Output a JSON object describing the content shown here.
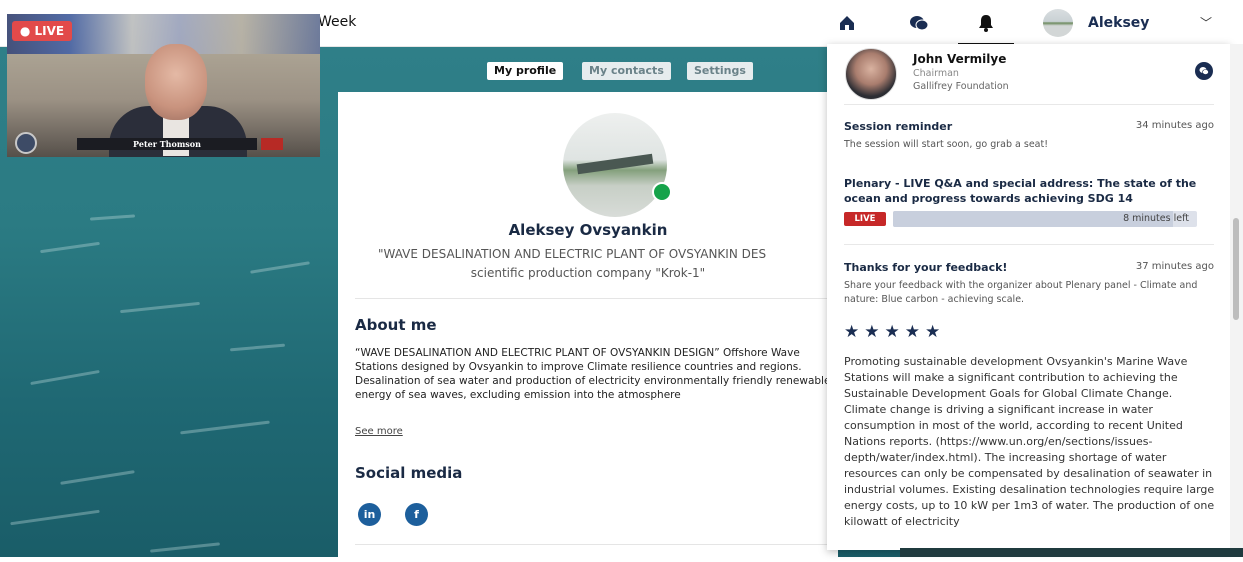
{
  "header": {
    "brand_text": "Week",
    "nav": [
      {
        "icon": "home-icon"
      },
      {
        "icon": "chat-icon"
      },
      {
        "icon": "bell-icon",
        "active": true
      }
    ],
    "user_name": "Aleksey",
    "chevron": "﹀"
  },
  "video": {
    "live_label": "● LIVE",
    "speaker_name": "Peter Thomson"
  },
  "tabs": [
    "My profile",
    "My contacts",
    "Settings"
  ],
  "profile": {
    "name": "Aleksey Ovsyankin",
    "title": "\"WAVE DESALINATION AND ELECTRIC PLANT OF OVSYANKIN DES",
    "company": "scientific production company \"Krok-1\"",
    "about_heading": "About me",
    "about_text": "“WAVE DESALINATION AND ELECTRIC PLANT OF OVSYANKIN DESIGN” Offshore Wave Stations designed by Ovsyankin to improve Climate resilience countries and regions. Desalination of sea water and production of electricity environmentally friendly renewable energy of sea waves, excluding emission into the atmosphere",
    "see_more": "See more",
    "social_heading": "Social media",
    "social": [
      {
        "label": "in",
        "icon": "linkedin-icon"
      },
      {
        "label": "f",
        "icon": "facebook-icon"
      }
    ]
  },
  "notifications": {
    "contact": {
      "name": "John Vermilye",
      "role": "Chairman",
      "org": "Gallifrey Foundation"
    },
    "reminder": {
      "title": "Session reminder",
      "time": "34 minutes ago",
      "body": "The session will start soon, go grab a seat!",
      "session_title": "Plenary - LIVE Q&A and special address: The state of the ocean and progress towards achieving SDG 14",
      "live_tag": "LIVE",
      "time_left": "8 minutes left",
      "progress_fraction": 0.92
    },
    "feedback": {
      "title": "Thanks for your feedback!",
      "time": "37 minutes ago",
      "body": "Share your feedback with the organizer about Plenary panel - Climate and nature: Blue carbon - achieving scale.",
      "stars": "★★★★★",
      "rating": 5,
      "text": "Promoting sustainable development Ovsyankin's Marine Wave Stations will make a significant contribution to achieving the Sustainable Development Goals for Global Climate Change. Climate change is driving a significant increase in water consumption in most of the world, according to recent United Nations reports. (https://www.un.org/en/sections/issues-depth/water/index.html). The increasing shortage of water resources can only be compensated by desalination of seawater in industrial volumes. Existing desalination technologies require large energy costs, up to 10 kW per 1m3 of water. The production of one kilowatt of electricity"
    }
  },
  "colors": {
    "navy": "#1a2d52",
    "live_red": "#e24a4a",
    "online_green": "#16a34a",
    "ocean": "#2b7b83"
  }
}
